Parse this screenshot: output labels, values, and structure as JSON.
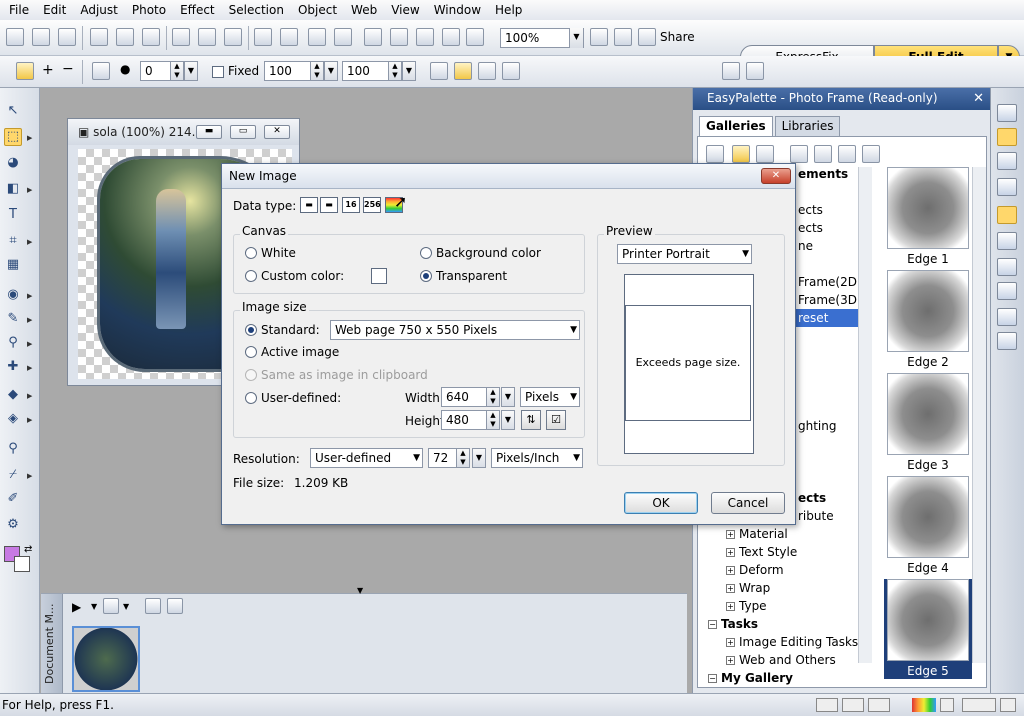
{
  "menu": [
    "File",
    "Edit",
    "Adjust",
    "Photo",
    "Effect",
    "Selection",
    "Object",
    "Web",
    "View",
    "Window",
    "Help"
  ],
  "toolbar1": {
    "zoom_value": "100%",
    "share_label": "Share",
    "expressfix_label": "ExpressFix",
    "fulledit_label": "Full Edit"
  },
  "toolbar2": {
    "feather_value": "0",
    "fixed_label": "Fixed",
    "width_value": "100",
    "height_value": "100"
  },
  "document": {
    "title": "sola (100%) 214..."
  },
  "filmstrip": {
    "label": "Document M..."
  },
  "status": {
    "text": "For Help, press F1."
  },
  "panel": {
    "title": "EasyPalette - Photo Frame (Read-only)",
    "tabs": [
      "Galleries",
      "Libraries"
    ],
    "tree": [
      {
        "text": "ements",
        "bold": true,
        "indent": 96
      },
      {
        "text": "",
        "indent": 96
      },
      {
        "text": "ects",
        "indent": 96
      },
      {
        "text": "ects",
        "indent": 96
      },
      {
        "text": "ne",
        "indent": 96
      },
      {
        "text": "",
        "indent": 96
      },
      {
        "text": "Frame(2D)",
        "indent": 96
      },
      {
        "text": "Frame(3D)",
        "indent": 96
      },
      {
        "text": "reset",
        "indent": 96,
        "selected": true
      },
      {
        "text": "",
        "indent": 96
      },
      {
        "text": "",
        "indent": 96
      },
      {
        "text": "",
        "indent": 96
      },
      {
        "text": "",
        "indent": 96
      },
      {
        "text": "",
        "indent": 96
      },
      {
        "text": "ghting",
        "indent": 96
      },
      {
        "text": "",
        "indent": 96
      },
      {
        "text": "",
        "indent": 96
      },
      {
        "text": "",
        "indent": 96
      },
      {
        "text": "ects",
        "bold": true,
        "indent": 96
      },
      {
        "text": "ribute",
        "indent": 96
      },
      {
        "text": "Material",
        "indent": 24,
        "box": "+"
      },
      {
        "text": "Text Style",
        "indent": 24,
        "box": "+"
      },
      {
        "text": "Deform",
        "indent": 24,
        "box": "+"
      },
      {
        "text": "Wrap",
        "indent": 24,
        "box": "+"
      },
      {
        "text": "Type",
        "indent": 24,
        "box": "+"
      },
      {
        "text": "Tasks",
        "bold": true,
        "indent": 6,
        "box": "−"
      },
      {
        "text": "Image Editing Tasks",
        "indent": 24,
        "box": "+"
      },
      {
        "text": "Web and Others",
        "indent": 24,
        "box": "+"
      },
      {
        "text": "My Gallery",
        "bold": true,
        "indent": 6,
        "box": "−"
      }
    ],
    "gallery": [
      {
        "label": "Edge 1"
      },
      {
        "label": "Edge 2"
      },
      {
        "label": "Edge 3"
      },
      {
        "label": "Edge 4"
      },
      {
        "label": "Edge 5",
        "selected": true
      }
    ]
  },
  "dialog": {
    "title": "New Image",
    "data_type_label": "Data type:",
    "data_type_buttons": [
      "",
      "",
      "16",
      "256",
      ""
    ],
    "canvas_label": "Canvas",
    "white_label": "White",
    "custom_color_label": "Custom color:",
    "background_color_label": "Background color",
    "transparent_label": "Transparent",
    "image_size_label": "Image size",
    "standard_label": "Standard:",
    "standard_value": "Web page 750 x 550 Pixels",
    "active_image_label": "Active image",
    "clipboard_label": "Same as image in clipboard",
    "user_defined_label": "User-defined:",
    "width_label": "Width:",
    "width_value": "640",
    "height_label": "Height:",
    "height_value": "480",
    "units_value": "Pixels",
    "resolution_label": "Resolution:",
    "resolution_mode": "User-defined",
    "resolution_value": "72",
    "resolution_units": "Pixels/Inch",
    "file_size_label": "File size:",
    "file_size_value": "1.209 KB",
    "preview_label": "Preview",
    "preview_select": "Printer Portrait",
    "preview_text": "Exceeds page size.",
    "ok_label": "OK",
    "cancel_label": "Cancel"
  }
}
